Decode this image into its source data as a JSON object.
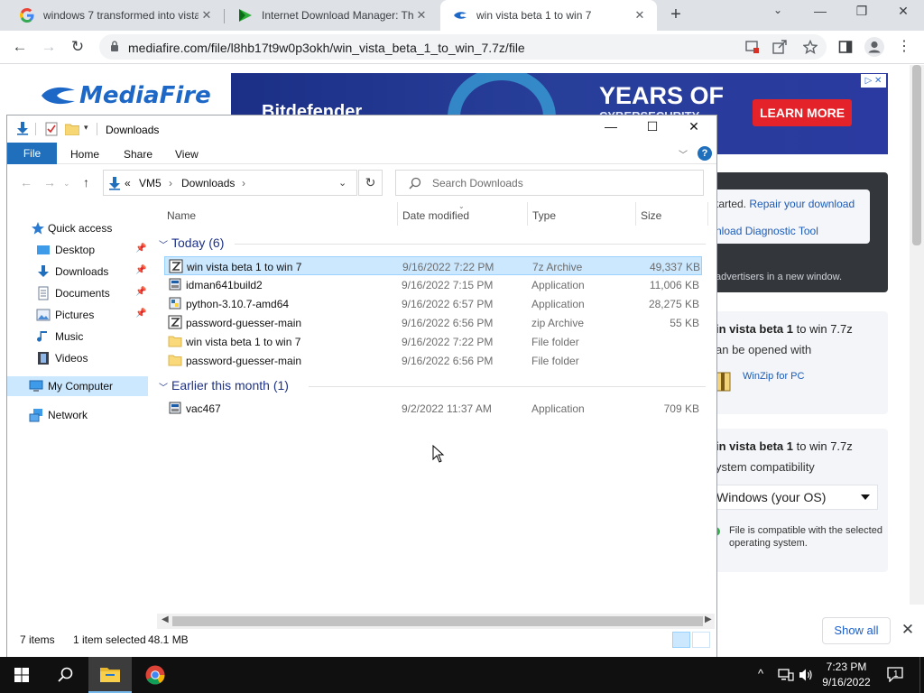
{
  "browser": {
    "tabs": [
      {
        "title": "windows 7 transformed into vista",
        "icon": "google-g-icon"
      },
      {
        "title": "Internet Download Manager: The",
        "icon": "idm-play-icon"
      },
      {
        "title": "win vista beta 1 to win 7",
        "icon": "mediafire-icon",
        "active": true
      }
    ],
    "url": "mediafire.com/file/l8hb17t9w0p3okh/win_vista_beta_1_to_win_7.7z/file"
  },
  "mediafire": {
    "logo_text": "MediaFire",
    "ad": {
      "brand": "Bitdefender",
      "headline": "YEARS OF",
      "subline": "CYBERSECURITY",
      "cta": "LEARN MORE"
    },
    "help_panel": {
      "line1_prefix": "tarted.",
      "line1_link": "Repair your download",
      "line2_link": "nload Diagnostic Tool",
      "advertisers_note": "advertisers in a new window."
    },
    "open_card": {
      "title_prefix": "in vista beta",
      "title_bold": "1",
      "title_mid": "to win 7.7z",
      "subtitle": "an be opened with",
      "app": "WinZip for PC"
    },
    "compat_card": {
      "title_prefix": "in vista beta",
      "title_bold": "1",
      "title_mid": "to win 7.7z",
      "subtitle": "ystem compatibility",
      "os_select": "Windows (your OS)",
      "compat_msg": "File is compatible with the selected operating system."
    },
    "show_all": "Show all"
  },
  "explorer": {
    "title": "Downloads",
    "ribbon_tabs": [
      "File",
      "Home",
      "Share",
      "View"
    ],
    "breadcrumb": [
      "«",
      "VM5",
      "Downloads"
    ],
    "search_placeholder": "Search Downloads",
    "nav": [
      {
        "label": "Quick access",
        "icon": "star-icon",
        "pinned": false
      },
      {
        "label": "Desktop",
        "icon": "desktop-icon",
        "pinned": true
      },
      {
        "label": "Downloads",
        "icon": "download-arrow-icon",
        "pinned": true
      },
      {
        "label": "Documents",
        "icon": "documents-icon",
        "pinned": true
      },
      {
        "label": "Pictures",
        "icon": "pictures-icon",
        "pinned": true
      },
      {
        "label": "Music",
        "icon": "music-icon",
        "pinned": false
      },
      {
        "label": "Videos",
        "icon": "videos-icon",
        "pinned": false
      },
      {
        "label": "My Computer",
        "icon": "computer-icon",
        "selected": true
      },
      {
        "label": "Network",
        "icon": "network-icon"
      }
    ],
    "columns": [
      "Name",
      "Date modified",
      "Type",
      "Size"
    ],
    "groups": [
      {
        "label": "Today (6)",
        "files": [
          {
            "name": "win vista beta 1 to win 7",
            "date": "9/16/2022 7:22 PM",
            "type": "7z Archive",
            "size": "49,337 KB",
            "icon": "archive-icon",
            "selected": true
          },
          {
            "name": "idman641build2",
            "date": "9/16/2022 7:15 PM",
            "type": "Application",
            "size": "11,006 KB",
            "icon": "installer-icon"
          },
          {
            "name": "python-3.10.7-amd64",
            "date": "9/16/2022 6:57 PM",
            "type": "Application",
            "size": "28,275 KB",
            "icon": "python-installer-icon"
          },
          {
            "name": "password-guesser-main",
            "date": "9/16/2022 6:56 PM",
            "type": "zip Archive",
            "size": "55 KB",
            "icon": "archive-icon"
          },
          {
            "name": "win vista beta 1 to win 7",
            "date": "9/16/2022 7:22 PM",
            "type": "File folder",
            "size": "",
            "icon": "folder-icon"
          },
          {
            "name": "password-guesser-main",
            "date": "9/16/2022 6:56 PM",
            "type": "File folder",
            "size": "",
            "icon": "folder-icon"
          }
        ]
      },
      {
        "label": "Earlier this month (1)",
        "files": [
          {
            "name": "vac467",
            "date": "9/2/2022 11:37 AM",
            "type": "Application",
            "size": "709 KB",
            "icon": "installer-icon"
          }
        ]
      }
    ],
    "status": {
      "count": "7 items",
      "selected": "1 item selected",
      "size": "48.1 MB"
    }
  },
  "taskbar": {
    "time": "7:23 PM",
    "date": "9/16/2022",
    "notification_count": "1"
  }
}
